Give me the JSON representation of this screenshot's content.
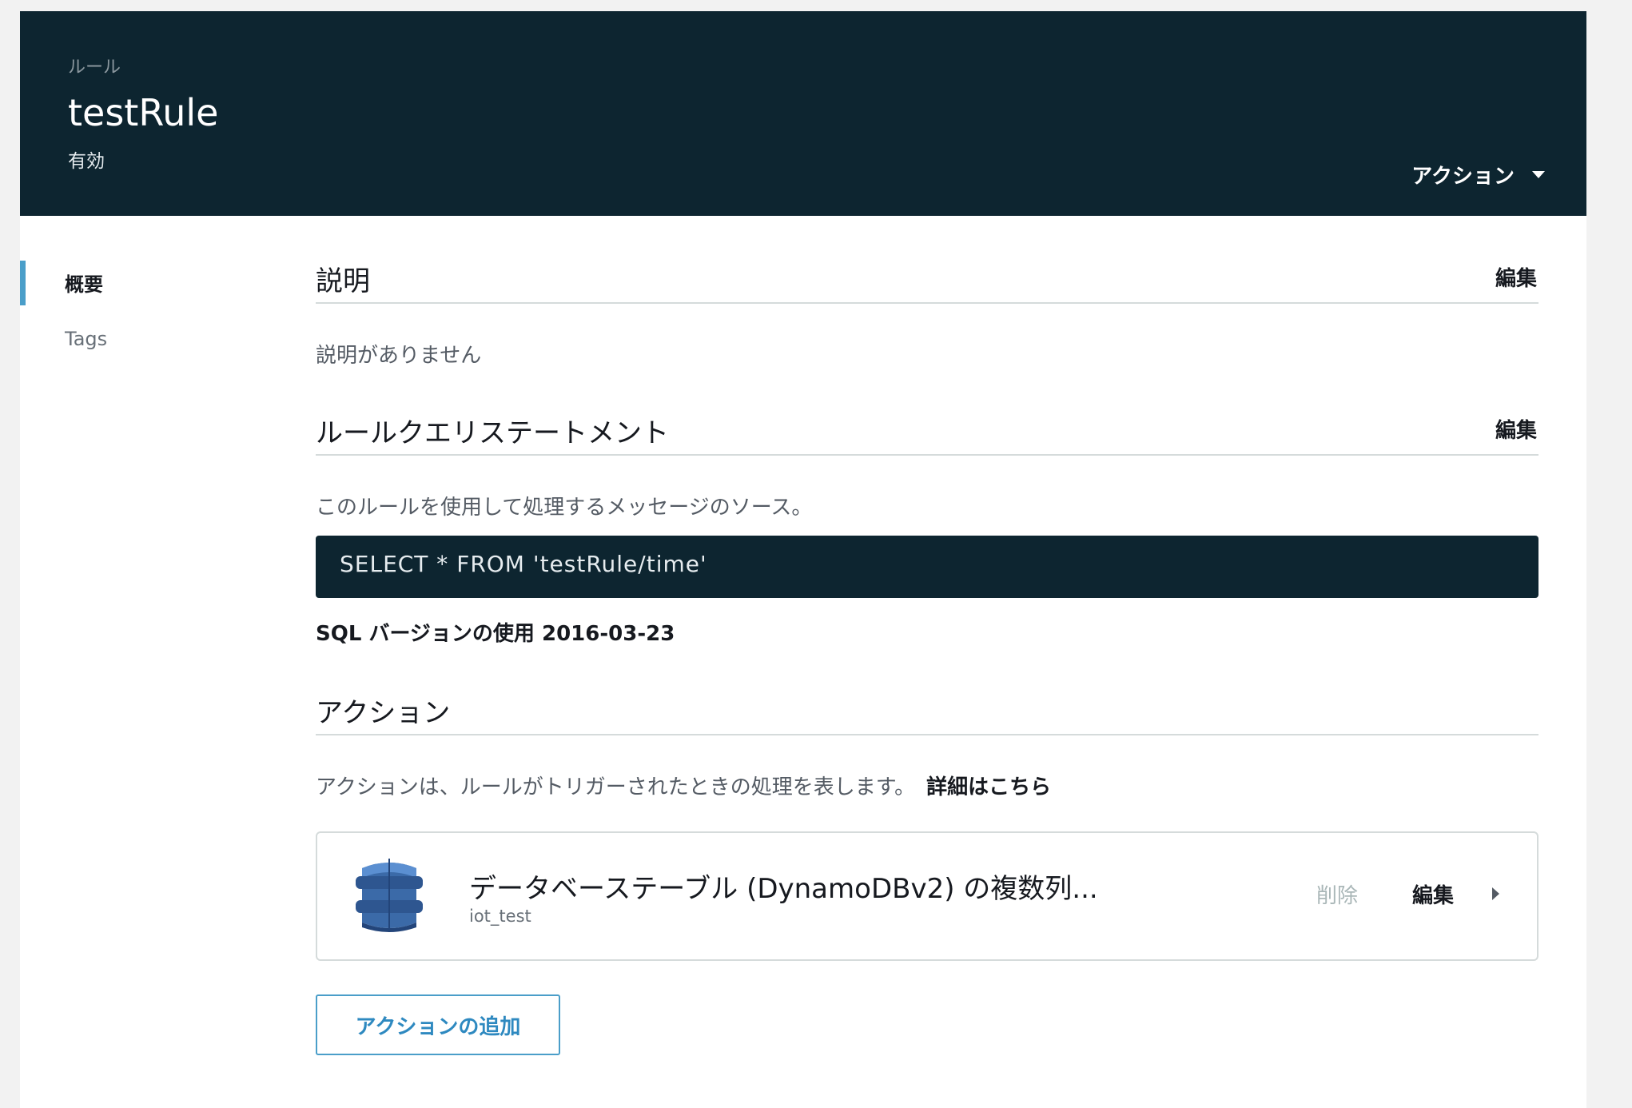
{
  "header": {
    "breadcrumb": "ルール",
    "title": "testRule",
    "status": "有効",
    "actions_label": "アクション"
  },
  "sidebar": {
    "items": [
      {
        "label": "概要",
        "active": true
      },
      {
        "label": "Tags",
        "active": false
      }
    ]
  },
  "description": {
    "title": "説明",
    "edit_label": "編集",
    "text": "説明がありません"
  },
  "query": {
    "title": "ルールクエリステートメント",
    "edit_label": "編集",
    "subtitle": "このルールを使用して処理するメッセージのソース。",
    "sql": "SELECT * FROM 'testRule/time'",
    "sql_version": "SQL バージョンの使用 2016-03-23"
  },
  "actions": {
    "title": "アクション",
    "description": "アクションは、ルールがトリガーされたときの処理を表します。",
    "learn_more": "詳細はこちら",
    "items": [
      {
        "icon": "dynamodb-icon",
        "title": "データベーステーブル (DynamoDBv2) の複数列...",
        "subtitle": "iot_test",
        "delete_label": "削除",
        "edit_label": "編集"
      }
    ],
    "add_label": "アクションの追加"
  },
  "colors": {
    "header_bg": "#0d2530",
    "accent": "#4a9ec9",
    "link_blue": "#2e89c0"
  }
}
